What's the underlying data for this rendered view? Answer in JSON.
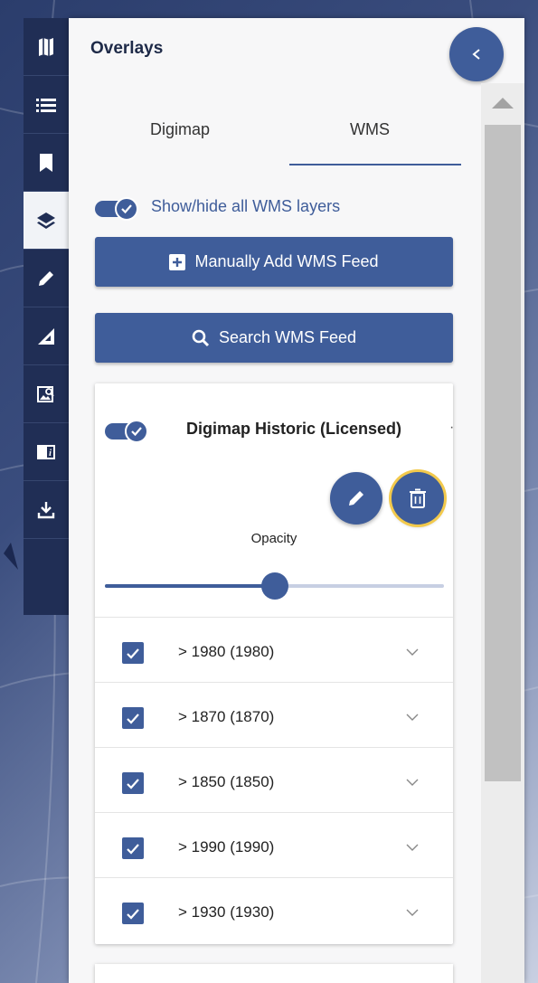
{
  "panel": {
    "title": "Overlays",
    "tabs": [
      {
        "label": "Digimap",
        "active": false
      },
      {
        "label": "WMS",
        "active": true
      }
    ],
    "show_all": {
      "label": "Show/hide all WMS layers",
      "checked": true
    },
    "manual_add_label": "Manually Add WMS Feed",
    "search_label": "Search WMS Feed"
  },
  "rail": {
    "items": [
      {
        "icon": "map-icon",
        "active": false
      },
      {
        "icon": "list-icon",
        "active": false
      },
      {
        "icon": "bookmark-icon",
        "active": false
      },
      {
        "icon": "layers-icon",
        "active": true
      },
      {
        "icon": "pencil-icon",
        "active": false
      },
      {
        "icon": "measure-icon",
        "active": false
      },
      {
        "icon": "image-search-icon",
        "active": false
      },
      {
        "icon": "info-icon",
        "active": false
      },
      {
        "icon": "download-icon",
        "active": false
      }
    ]
  },
  "feed": {
    "title": "Digimap Historic (Licensed)",
    "enabled": true,
    "opacity_label": "Opacity",
    "opacity_value": 0.5,
    "layers": [
      {
        "label": "> 1980 (1980)",
        "checked": true
      },
      {
        "label": "> 1870 (1870)",
        "checked": true
      },
      {
        "label": "> 1850 (1850)",
        "checked": true
      },
      {
        "label": "> 1990 (1990)",
        "checked": true
      },
      {
        "label": "> 1930 (1930)",
        "checked": true
      }
    ]
  },
  "colors": {
    "accent": "#3f5d9a",
    "rail": "#202e55",
    "focus_ring": "#f2c94c"
  }
}
